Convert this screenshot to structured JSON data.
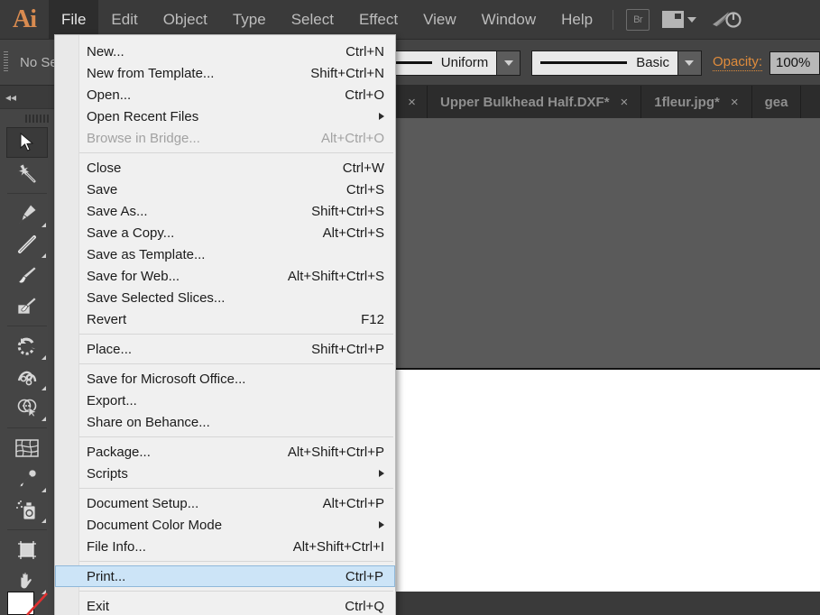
{
  "app": {
    "name": "Adobe Illustrator",
    "logo_text": "Ai"
  },
  "menubar": {
    "items": [
      {
        "label": "File",
        "active": true
      },
      {
        "label": "Edit",
        "active": false
      },
      {
        "label": "Object",
        "active": false
      },
      {
        "label": "Type",
        "active": false
      },
      {
        "label": "Select",
        "active": false
      },
      {
        "label": "Effect",
        "active": false
      },
      {
        "label": "View",
        "active": false
      },
      {
        "label": "Window",
        "active": false
      },
      {
        "label": "Help",
        "active": false
      }
    ],
    "bridge_label": "Br",
    "workspace_label": "",
    "accent_color": "#d98b50"
  },
  "controlbar": {
    "no_selection_label": "No Se",
    "stroke_profile": "Uniform",
    "brush_definition": "Basic",
    "opacity_label": "Opacity:",
    "opacity_value": "100%",
    "accent_color": "#e08c3c"
  },
  "tabbar": {
    "tabs": [
      {
        "label": "Upper Bulkhead Half.DXF*",
        "close": "×"
      },
      {
        "label": "1fleur.jpg*",
        "close": "×"
      },
      {
        "label": "gea",
        "close": ""
      }
    ],
    "leading_close": "×"
  },
  "toolbar": {
    "collapse_label": "◂◂",
    "tools": [
      {
        "name": "selection-tool",
        "selected": true
      },
      {
        "name": "magic-wand-tool",
        "selected": false
      },
      {
        "name": "pen-tool",
        "selected": false
      },
      {
        "name": "line-segment-tool",
        "selected": false
      },
      {
        "name": "paintbrush-tool",
        "selected": false
      },
      {
        "name": "blob-brush-tool",
        "selected": false
      },
      {
        "name": "rotate-tool",
        "selected": false
      },
      {
        "name": "width-tool",
        "selected": false
      },
      {
        "name": "shape-builder-tool",
        "selected": false
      },
      {
        "name": "mesh-tool",
        "selected": false
      },
      {
        "name": "eyedropper-tool",
        "selected": false
      },
      {
        "name": "symbol-sprayer-tool",
        "selected": false
      },
      {
        "name": "artboard-tool",
        "selected": false
      },
      {
        "name": "hand-tool",
        "selected": false
      }
    ],
    "swap_icon": "⇄"
  },
  "file_menu": {
    "title": "File",
    "groups": [
      {
        "items": [
          {
            "label": "New...",
            "accel": "Ctrl+N",
            "disabled": false,
            "submenu": false,
            "highlight": false
          },
          {
            "label": "New from Template...",
            "accel": "Shift+Ctrl+N",
            "disabled": false,
            "submenu": false,
            "highlight": false
          },
          {
            "label": "Open...",
            "accel": "Ctrl+O",
            "disabled": false,
            "submenu": false,
            "highlight": false
          },
          {
            "label": "Open Recent Files",
            "accel": "",
            "disabled": false,
            "submenu": true,
            "highlight": false
          },
          {
            "label": "Browse in Bridge...",
            "accel": "Alt+Ctrl+O",
            "disabled": true,
            "submenu": false,
            "highlight": false
          }
        ]
      },
      {
        "items": [
          {
            "label": "Close",
            "accel": "Ctrl+W",
            "disabled": false,
            "submenu": false,
            "highlight": false
          },
          {
            "label": "Save",
            "accel": "Ctrl+S",
            "disabled": false,
            "submenu": false,
            "highlight": false
          },
          {
            "label": "Save As...",
            "accel": "Shift+Ctrl+S",
            "disabled": false,
            "submenu": false,
            "highlight": false
          },
          {
            "label": "Save a Copy...",
            "accel": "Alt+Ctrl+S",
            "disabled": false,
            "submenu": false,
            "highlight": false
          },
          {
            "label": "Save as Template...",
            "accel": "",
            "disabled": false,
            "submenu": false,
            "highlight": false
          },
          {
            "label": "Save for Web...",
            "accel": "Alt+Shift+Ctrl+S",
            "disabled": false,
            "submenu": false,
            "highlight": false
          },
          {
            "label": "Save Selected Slices...",
            "accel": "",
            "disabled": false,
            "submenu": false,
            "highlight": false
          },
          {
            "label": "Revert",
            "accel": "F12",
            "disabled": false,
            "submenu": false,
            "highlight": false
          }
        ]
      },
      {
        "items": [
          {
            "label": "Place...",
            "accel": "Shift+Ctrl+P",
            "disabled": false,
            "submenu": false,
            "highlight": false
          }
        ]
      },
      {
        "items": [
          {
            "label": "Save for Microsoft Office...",
            "accel": "",
            "disabled": false,
            "submenu": false,
            "highlight": false
          },
          {
            "label": "Export...",
            "accel": "",
            "disabled": false,
            "submenu": false,
            "highlight": false
          },
          {
            "label": "Share on Behance...",
            "accel": "",
            "disabled": false,
            "submenu": false,
            "highlight": false
          }
        ]
      },
      {
        "items": [
          {
            "label": "Package...",
            "accel": "Alt+Shift+Ctrl+P",
            "disabled": false,
            "submenu": false,
            "highlight": false
          },
          {
            "label": "Scripts",
            "accel": "",
            "disabled": false,
            "submenu": true,
            "highlight": false
          }
        ]
      },
      {
        "items": [
          {
            "label": "Document Setup...",
            "accel": "Alt+Ctrl+P",
            "disabled": false,
            "submenu": false,
            "highlight": false
          },
          {
            "label": "Document Color Mode",
            "accel": "",
            "disabled": false,
            "submenu": true,
            "highlight": false
          },
          {
            "label": "File Info...",
            "accel": "Alt+Shift+Ctrl+I",
            "disabled": false,
            "submenu": false,
            "highlight": false
          }
        ]
      },
      {
        "items": [
          {
            "label": "Print...",
            "accel": "Ctrl+P",
            "disabled": false,
            "submenu": false,
            "highlight": true
          }
        ]
      },
      {
        "items": [
          {
            "label": "Exit",
            "accel": "Ctrl+Q",
            "disabled": false,
            "submenu": false,
            "highlight": false
          }
        ]
      }
    ],
    "highlight_color": "#cce4f7"
  },
  "canvas": {
    "artwork_stroke_color": "#f08080",
    "background_color": "#5a5a5a",
    "artboard_color": "#ffffff"
  }
}
